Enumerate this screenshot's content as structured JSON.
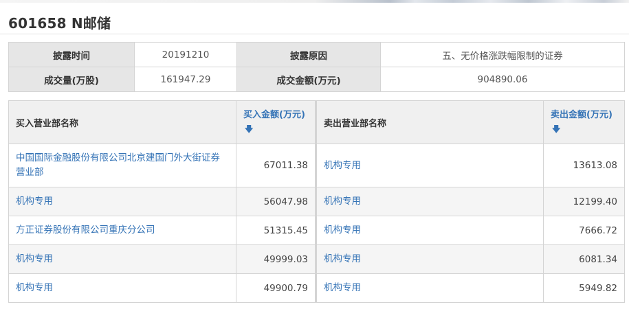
{
  "header": {
    "title": "601658 N邮储"
  },
  "summary": {
    "disclosure_time_label": "披露时间",
    "disclosure_time_value": "20191210",
    "disclosure_reason_label": "披露原因",
    "disclosure_reason_value": "五、无价格涨跌幅限制的证券",
    "volume_label": "成交量(万股)",
    "volume_value": "161947.29",
    "amount_label": "成交金额(万元)",
    "amount_value": "904890.06"
  },
  "trades": {
    "headers": {
      "buy_dept": "买入营业部名称",
      "buy_amount": "买入金额(万元)",
      "sell_dept": "卖出营业部名称",
      "sell_amount": "卖出金额(万元)",
      "sort_arrow": "🡇"
    },
    "rows": [
      {
        "buy_name": "中国国际金融股份有限公司北京建国门外大街证券营业部",
        "buy_amount": "67011.38",
        "sell_name": "机构专用",
        "sell_amount": "13613.08"
      },
      {
        "buy_name": "机构专用",
        "buy_amount": "56047.98",
        "sell_name": "机构专用",
        "sell_amount": "12199.40"
      },
      {
        "buy_name": "方正证券股份有限公司重庆分公司",
        "buy_amount": "51315.45",
        "sell_name": "机构专用",
        "sell_amount": "7666.72"
      },
      {
        "buy_name": "机构专用",
        "buy_amount": "49999.03",
        "sell_name": "机构专用",
        "sell_amount": "6081.34"
      },
      {
        "buy_name": "机构专用",
        "buy_amount": "49900.79",
        "sell_name": "机构专用",
        "sell_amount": "5949.82"
      }
    ]
  }
}
